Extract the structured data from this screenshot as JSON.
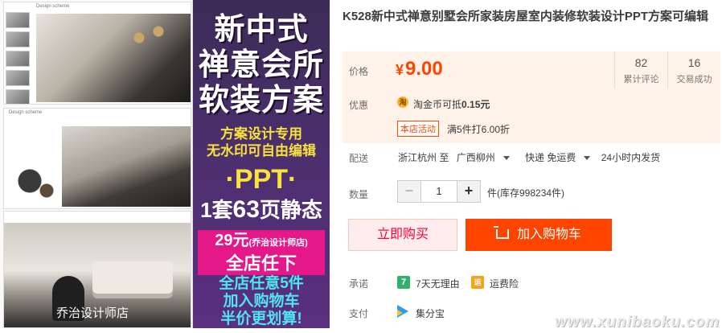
{
  "product": {
    "title": "K528新中式禅意别墅会所家装房屋室内装修软装设计PPT方案可编辑",
    "image": {
      "slide_caption_1": "Design scheme",
      "slide_caption_2": "Design scheme",
      "banner_line_1": "新中式",
      "banner_line_2": "禅意会所",
      "banner_line_3": "软装方案",
      "banner_yellow_1": "方案设计专用",
      "banner_yellow_2": "无水印可自由编辑",
      "banner_ppt": "·PPT·",
      "banner_pages_prefix": "1套",
      "banner_pages_num": "63",
      "banner_pages_suffix": "页静态",
      "banner_box_price": "29元",
      "banner_box_shop": "(乔治设计师店)",
      "banner_box_line2": "全店任下",
      "banner_cyan_1": "全店任意5件",
      "banner_cyan_2": "加入购物车",
      "banner_cyan_3": "半价更划算!",
      "watermark": "乔治设计师店"
    }
  },
  "price": {
    "label": "价格",
    "currency": "¥",
    "value": "9.00",
    "stats": [
      {
        "num": "82",
        "label": "累计评论"
      },
      {
        "num": "16",
        "label": "交易成功"
      }
    ]
  },
  "discount": {
    "label": "优惠",
    "coin_icon": "淘",
    "coin_text": "淘金币可抵",
    "coin_amount": "0.15元",
    "tag": "本店活动",
    "promo": "满5件打6.00折"
  },
  "shipping": {
    "label": "配送",
    "from": "浙江杭州 至",
    "to": "广西柳州",
    "fee": "快递 免运费",
    "time": "24小时内发货"
  },
  "quantity": {
    "label": "数量",
    "minus": "−",
    "value": "1",
    "plus": "+",
    "stock": "件(库存998234件)"
  },
  "actions": {
    "buy_now": "立即购买",
    "add_cart": "加入购物车"
  },
  "promise": {
    "label": "承诺",
    "item1_icon": "7",
    "item1_text": "7天无理由",
    "item2_icon": "运",
    "item2_text": "运费险"
  },
  "payment": {
    "label": "支付",
    "method": "集分宝"
  },
  "site_watermark": "www.xunibaoku.com",
  "colors": {
    "accent": "#ff4400",
    "price_bg": "#fff2e8",
    "banner_purple": "#4b2f6d",
    "banner_magenta": "#e5188a"
  }
}
